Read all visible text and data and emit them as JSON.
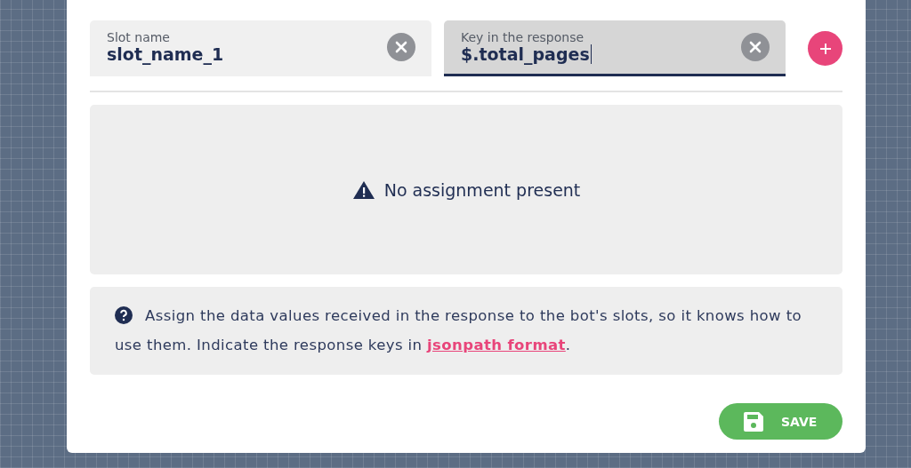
{
  "fields": [
    {
      "label": "Slot name",
      "value": "slot_name_1",
      "focused": false
    },
    {
      "label": "Key in the response",
      "value": "$.total_pages",
      "focused": true
    }
  ],
  "empty_state": {
    "message": "No assignment present"
  },
  "help": {
    "text": "Assign the data values received in the response to the bot's slots, so it knows how to use them. Indicate the response keys in ",
    "link": "jsonpath format",
    "after": "."
  },
  "save_button": {
    "label": "SAVE"
  }
}
